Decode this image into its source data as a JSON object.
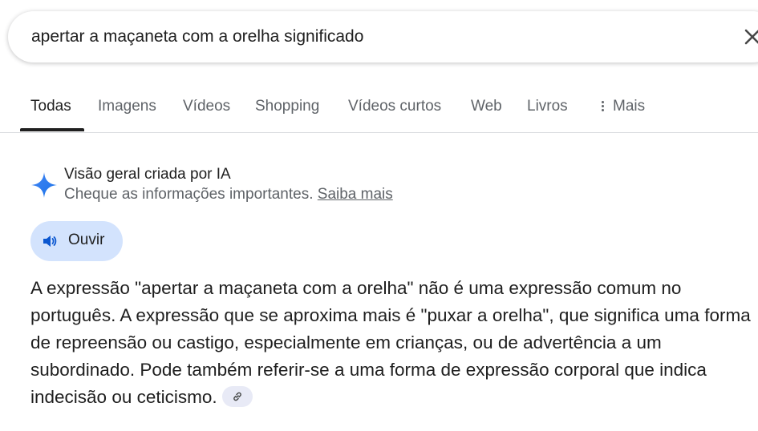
{
  "search": {
    "query": "apertar a maçaneta com a orelha significado"
  },
  "tabs": [
    {
      "label": "Todas",
      "active": true
    },
    {
      "label": "Imagens"
    },
    {
      "label": "Vídeos"
    },
    {
      "label": "Shopping"
    },
    {
      "label": "Vídeos curtos"
    },
    {
      "label": "Web"
    },
    {
      "label": "Livros"
    },
    {
      "label": "Mais"
    }
  ],
  "ai_overview": {
    "title": "Visão geral criada por IA",
    "subtitle": "Cheque as informações importantes.",
    "learn_more": "Saiba mais",
    "listen_label": "Ouvir",
    "answer": "A expressão \"apertar a maçaneta com a orelha\" não é uma expressão comum no português. A expressão que se aproxima mais é \"puxar a orelha\", que significa uma forma de repreensão ou castigo, especialmente em crianças, ou de advertência a um subordinado. Pode também referir-se a uma forma de expressão corporal que indica indecisão ou ceticismo."
  },
  "icons": {
    "clear": "close-icon",
    "ai": "sparkle-icon",
    "listen": "speaker-icon",
    "source": "link-icon",
    "more": "more-vert-icon"
  },
  "colors": {
    "accent_blue": "#4285f4",
    "listen_bg": "#d3e3fd",
    "muted_text": "#5f6368"
  }
}
